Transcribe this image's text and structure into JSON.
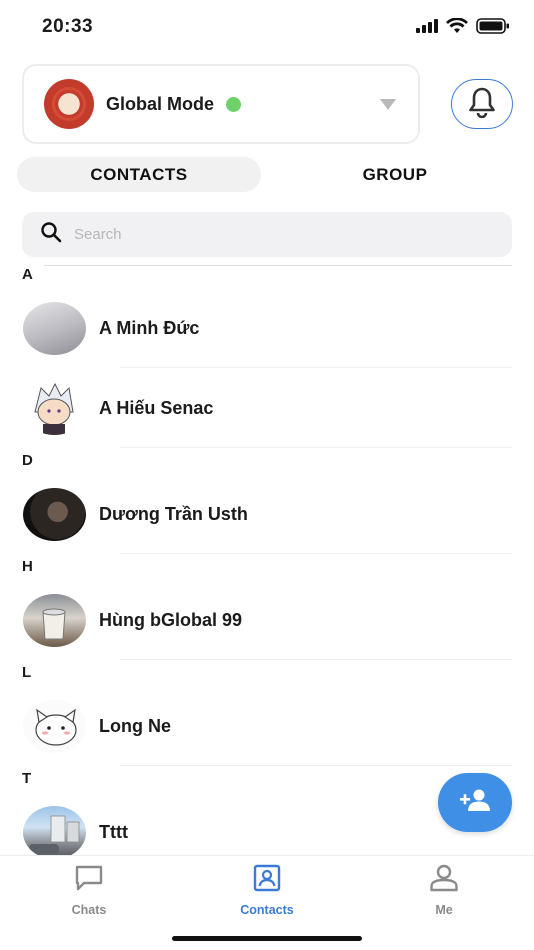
{
  "status_bar": {
    "time": "20:33",
    "icons": [
      "signal-icon",
      "wifi-icon",
      "battery-icon"
    ]
  },
  "header": {
    "mode_title": "Global Mode",
    "mode_status_color": "#6fd16a",
    "icons": [
      "dropdown-caret-icon",
      "bell-icon"
    ]
  },
  "tabs": [
    {
      "label": "CONTACTS",
      "active": true
    },
    {
      "label": "GROUP",
      "active": false
    }
  ],
  "search": {
    "placeholder": "Search",
    "value": ""
  },
  "sections": [
    {
      "letter": "A",
      "contacts": [
        {
          "name": "A Minh Đức"
        },
        {
          "name": "A Hiếu Senac"
        }
      ]
    },
    {
      "letter": "D",
      "contacts": [
        {
          "name": "Dương Trần Usth"
        }
      ]
    },
    {
      "letter": "H",
      "contacts": [
        {
          "name": "Hùng bGlobal 99"
        }
      ]
    },
    {
      "letter": "L",
      "contacts": [
        {
          "name": "Long Ne"
        }
      ]
    },
    {
      "letter": "T",
      "contacts": [
        {
          "name": "Tttt"
        }
      ]
    }
  ],
  "fab": {
    "icon": "add-person-icon"
  },
  "bottom_nav": [
    {
      "label": "Chats",
      "icon": "chat-bubble-icon",
      "active": false
    },
    {
      "label": "Contacts",
      "icon": "contacts-book-icon",
      "active": true
    },
    {
      "label": "Me",
      "icon": "person-icon",
      "active": false
    }
  ],
  "colors": {
    "accent": "#3a7bd5",
    "fab": "#3f8fe6",
    "online": "#6fd16a",
    "inactive_nav": "#8a8a8a"
  }
}
